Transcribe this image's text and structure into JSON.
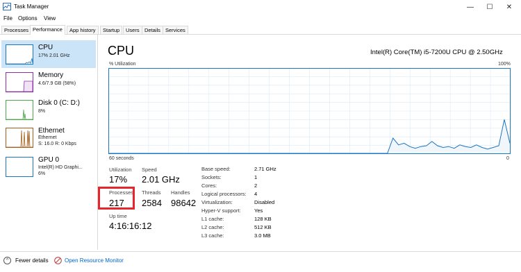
{
  "window": {
    "title": "Task Manager",
    "minimize_icon": "minimize-icon",
    "maximize_icon": "maximize-icon",
    "close_icon": "close-icon"
  },
  "menu": [
    "File",
    "Options",
    "View"
  ],
  "tabs": [
    "Processes",
    "Performance",
    "App history",
    "Startup",
    "Users",
    "Details",
    "Services"
  ],
  "active_tab": "Performance",
  "sidebar": [
    {
      "title": "CPU",
      "sub1": "17% 2.01 GHz",
      "sub2": "",
      "color": "#1a75c2"
    },
    {
      "title": "Memory",
      "sub1": "4.6/7.9 GB (58%)",
      "sub2": "",
      "color": "#8b2ea8"
    },
    {
      "title": "Disk 0 (C: D:)",
      "sub1": "8%",
      "sub2": "",
      "color": "#4ca64c"
    },
    {
      "title": "Ethernet",
      "sub1": "Ethernet",
      "sub2": "S: 16.0 R: 0 Kbps",
      "color": "#a75b16"
    },
    {
      "title": "GPU 0",
      "sub1": "Intel(R) HD Graphi...",
      "sub2": "6%",
      "color": "#1a75c2"
    }
  ],
  "main": {
    "title": "CPU",
    "model": "Intel(R) Core(TM) i5-7200U CPU @ 2.50GHz",
    "y_label": "% Utilization",
    "y_max": "100%",
    "x_left": "60 seconds",
    "x_right": "0",
    "graph_color": "#1a75c2",
    "utilization_history": [
      0,
      0,
      0,
      0,
      0,
      0,
      0,
      0,
      0,
      0,
      0,
      0,
      0,
      0,
      0,
      0,
      0,
      0,
      0,
      0,
      0,
      0,
      0,
      0,
      0,
      0,
      0,
      0,
      0,
      0,
      0,
      0,
      0,
      0,
      0,
      0,
      0,
      0,
      0,
      0,
      0,
      0,
      0,
      0,
      0,
      0,
      0,
      0,
      0,
      0,
      0,
      18,
      10,
      12,
      8,
      6,
      8,
      9,
      14,
      9,
      7,
      8,
      6,
      10,
      8,
      7,
      10,
      7,
      5,
      7,
      9,
      40,
      12
    ]
  },
  "stats": {
    "utilization_label": "Utilization",
    "utilization": "17%",
    "speed_label": "Speed",
    "speed": "2.01 GHz",
    "processes_label": "Processes",
    "processes": "217",
    "threads_label": "Threads",
    "threads": "2584",
    "handles_label": "Handles",
    "handles": "98642",
    "uptime_label": "Up time",
    "uptime": "4:16:16:12"
  },
  "info": [
    {
      "k": "Base speed:",
      "v": "2.71 GHz"
    },
    {
      "k": "Sockets:",
      "v": "1"
    },
    {
      "k": "Cores:",
      "v": "2"
    },
    {
      "k": "Logical processors:",
      "v": "4"
    },
    {
      "k": "Virtualization:",
      "v": "Disabled"
    },
    {
      "k": "Hyper-V support:",
      "v": "Yes"
    },
    {
      "k": "L1 cache:",
      "v": "128 KB"
    },
    {
      "k": "L2 cache:",
      "v": "512 KB"
    },
    {
      "k": "L3 cache:",
      "v": "3.0 MB"
    }
  ],
  "footer": {
    "fewer_details": "Fewer details",
    "open_monitor": "Open Resource Monitor"
  }
}
